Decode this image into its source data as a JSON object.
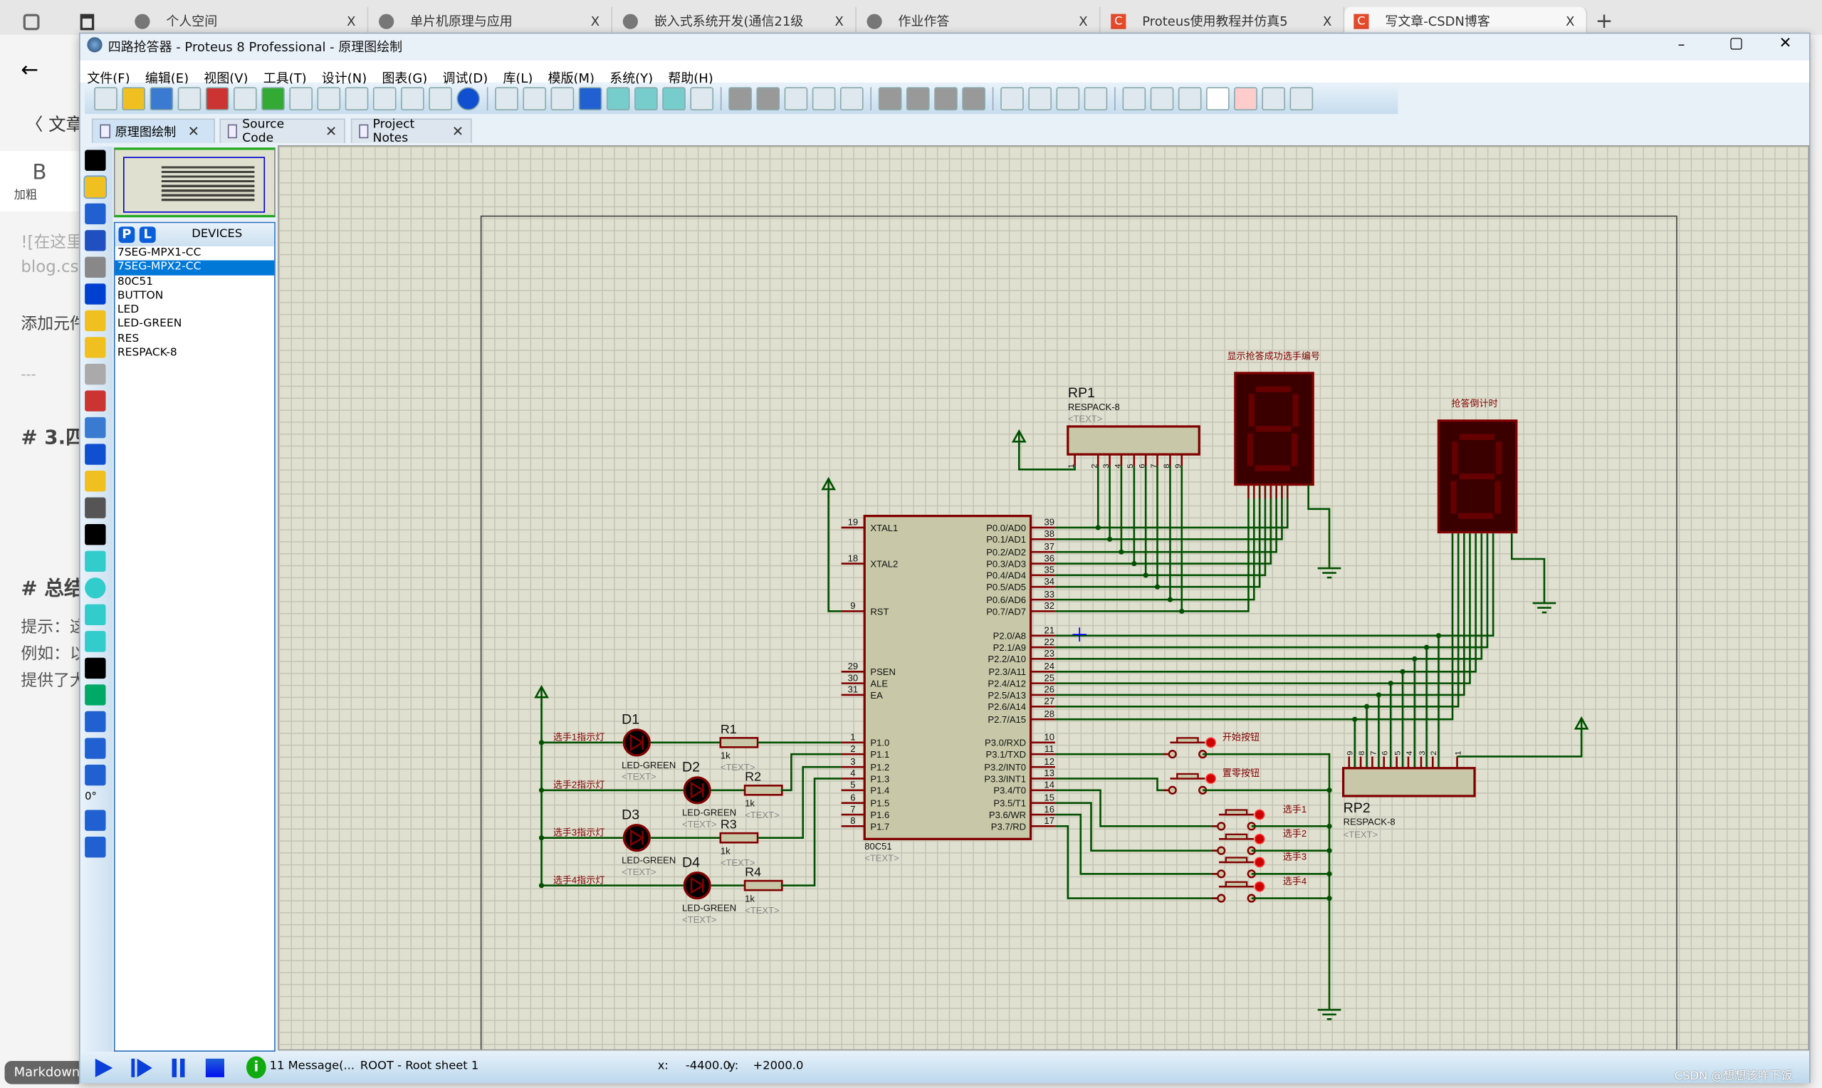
{
  "browser": {
    "tabs": [
      {
        "label": "个人空间",
        "icon": "globe-icon"
      },
      {
        "label": "单片机原理与应用",
        "icon": "globe-icon"
      },
      {
        "label": "嵌入式系统开发(通信21级",
        "icon": "globe-icon"
      },
      {
        "label": "作业作答",
        "icon": "globe-icon"
      },
      {
        "label": "Proteus使用教程并仿真5",
        "icon": "csdn-icon"
      },
      {
        "label": "写文章-CSDN博客",
        "icon": "csdn-icon"
      }
    ],
    "close": "X",
    "new_tab": "+"
  },
  "csdn_bg": {
    "back": "〈 文章",
    "bold_label": "B",
    "bold_caption": "加粗",
    "img_text": "![在这里",
    "url_text": "blog.csd",
    "add_text": "添加元件",
    "rule": "---",
    "heading3": "# 3.四",
    "heading_sum": "# 总结",
    "tip": "提示：这",
    "example": "例如：以",
    "provide": "提供了大",
    "markdown": "Markdown"
  },
  "window": {
    "title": "四路抢答器 - Proteus 8 Professional - 原理图绘制",
    "min": "–",
    "max": "▢",
    "close": "✕"
  },
  "menu": [
    "文件(F)",
    "编辑(E)",
    "视图(V)",
    "工具(T)",
    "设计(N)",
    "图表(G)",
    "调试(D)",
    "库(L)",
    "模版(M)",
    "系统(Y)",
    "帮助(H)"
  ],
  "doc_tabs": [
    {
      "label": "原理图绘制",
      "active": true
    },
    {
      "label": "Source Code"
    },
    {
      "label": "Project Notes"
    }
  ],
  "devices": {
    "p": "P",
    "l": "L",
    "header": "DEVICES",
    "items": [
      "7SEG-MPX1-CC",
      "7SEG-MPX2-CC",
      "80C51",
      "BUTTON",
      "LED",
      "LED-GREEN",
      "RES",
      "RESPACK-8"
    ],
    "selected": "7SEG-MPX2-CC"
  },
  "rotation": "0°",
  "status": {
    "messages": "11 Message(...",
    "sheet": "ROOT - Root sheet 1",
    "x_label": "x:",
    "x_value": "-4400.0",
    "y_label": "y:",
    "y_value": "+2000.0",
    "watermark": "CSDN @想想该咋下饭"
  },
  "colors": {
    "wire": "#005000",
    "component": "#800000",
    "grid_bg": "#e0e0d0",
    "body": "#c8c8a8",
    "selected": "#0078d7"
  },
  "schematic": {
    "chip": {
      "ref": "80C51",
      "text": "<TEXT>",
      "left": [
        {
          "n": "19",
          "p": "XTAL1"
        },
        {
          "n": "18",
          "p": "XTAL2"
        },
        {
          "n": "9",
          "p": "RST"
        },
        {
          "n": "29",
          "p": "PSEN"
        },
        {
          "n": "30",
          "p": "ALE"
        },
        {
          "n": "31",
          "p": "EA"
        },
        {
          "n": "1",
          "p": "P1.0"
        },
        {
          "n": "2",
          "p": "P1.1"
        },
        {
          "n": "3",
          "p": "P1.2"
        },
        {
          "n": "4",
          "p": "P1.3"
        },
        {
          "n": "5",
          "p": "P1.4"
        },
        {
          "n": "6",
          "p": "P1.5"
        },
        {
          "n": "7",
          "p": "P1.6"
        },
        {
          "n": "8",
          "p": "P1.7"
        }
      ],
      "right": [
        {
          "n": "39",
          "p": "P0.0/AD0"
        },
        {
          "n": "38",
          "p": "P0.1/AD1"
        },
        {
          "n": "37",
          "p": "P0.2/AD2"
        },
        {
          "n": "36",
          "p": "P0.3/AD3"
        },
        {
          "n": "35",
          "p": "P0.4/AD4"
        },
        {
          "n": "34",
          "p": "P0.5/AD5"
        },
        {
          "n": "33",
          "p": "P0.6/AD6"
        },
        {
          "n": "32",
          "p": "P0.7/AD7"
        },
        {
          "n": "21",
          "p": "P2.0/A8"
        },
        {
          "n": "22",
          "p": "P2.1/A9"
        },
        {
          "n": "23",
          "p": "P2.2/A10"
        },
        {
          "n": "24",
          "p": "P2.3/A11"
        },
        {
          "n": "25",
          "p": "P2.4/A12"
        },
        {
          "n": "26",
          "p": "P2.5/A13"
        },
        {
          "n": "27",
          "p": "P2.6/A14"
        },
        {
          "n": "28",
          "p": "P2.7/A15"
        },
        {
          "n": "10",
          "p": "P3.0/RXD"
        },
        {
          "n": "11",
          "p": "P3.1/TXD"
        },
        {
          "n": "12",
          "p": "P3.2/INT0"
        },
        {
          "n": "13",
          "p": "P3.3/INT1"
        },
        {
          "n": "14",
          "p": "P3.4/T0"
        },
        {
          "n": "15",
          "p": "P3.5/T1"
        },
        {
          "n": "16",
          "p": "P3.6/WR"
        },
        {
          "n": "17",
          "p": "P3.7/RD"
        }
      ]
    },
    "rp1": {
      "ref": "RP1",
      "value": "RESPACK-8",
      "text": "<TEXT>"
    },
    "rp2": {
      "ref": "RP2",
      "value": "RESPACK-8",
      "text": "<TEXT>"
    },
    "rp_pins": [
      "1",
      "2",
      "3",
      "4",
      "5",
      "6",
      "7",
      "8",
      "9"
    ],
    "seg1_label": "显示抢答成功选手编号",
    "seg2_label": "抢答倒计时",
    "leds": [
      {
        "ref": "D1",
        "value": "LED-GREEN",
        "text": "<TEXT>",
        "net": "选手1指示灯"
      },
      {
        "ref": "D2",
        "value": "LED-GREEN",
        "text": "<TEXT>",
        "net": "选手2指示灯"
      },
      {
        "ref": "D3",
        "value": "LED-GREEN",
        "text": "<TEXT>",
        "net": "选手3指示灯"
      },
      {
        "ref": "D4",
        "value": "LED-GREEN",
        "text": "<TEXT>",
        "net": "选手4指示灯"
      }
    ],
    "resistors": [
      {
        "ref": "R1",
        "value": "1k",
        "text": "<TEXT>"
      },
      {
        "ref": "R2",
        "value": "1k",
        "text": "<TEXT>"
      },
      {
        "ref": "R3",
        "value": "1k",
        "text": "<TEXT>"
      },
      {
        "ref": "R4",
        "value": "1k",
        "text": "<TEXT>"
      }
    ],
    "buttons": [
      "开始按钮",
      "置零按钮",
      "选手1",
      "选手2",
      "选手3",
      "选手4"
    ]
  }
}
